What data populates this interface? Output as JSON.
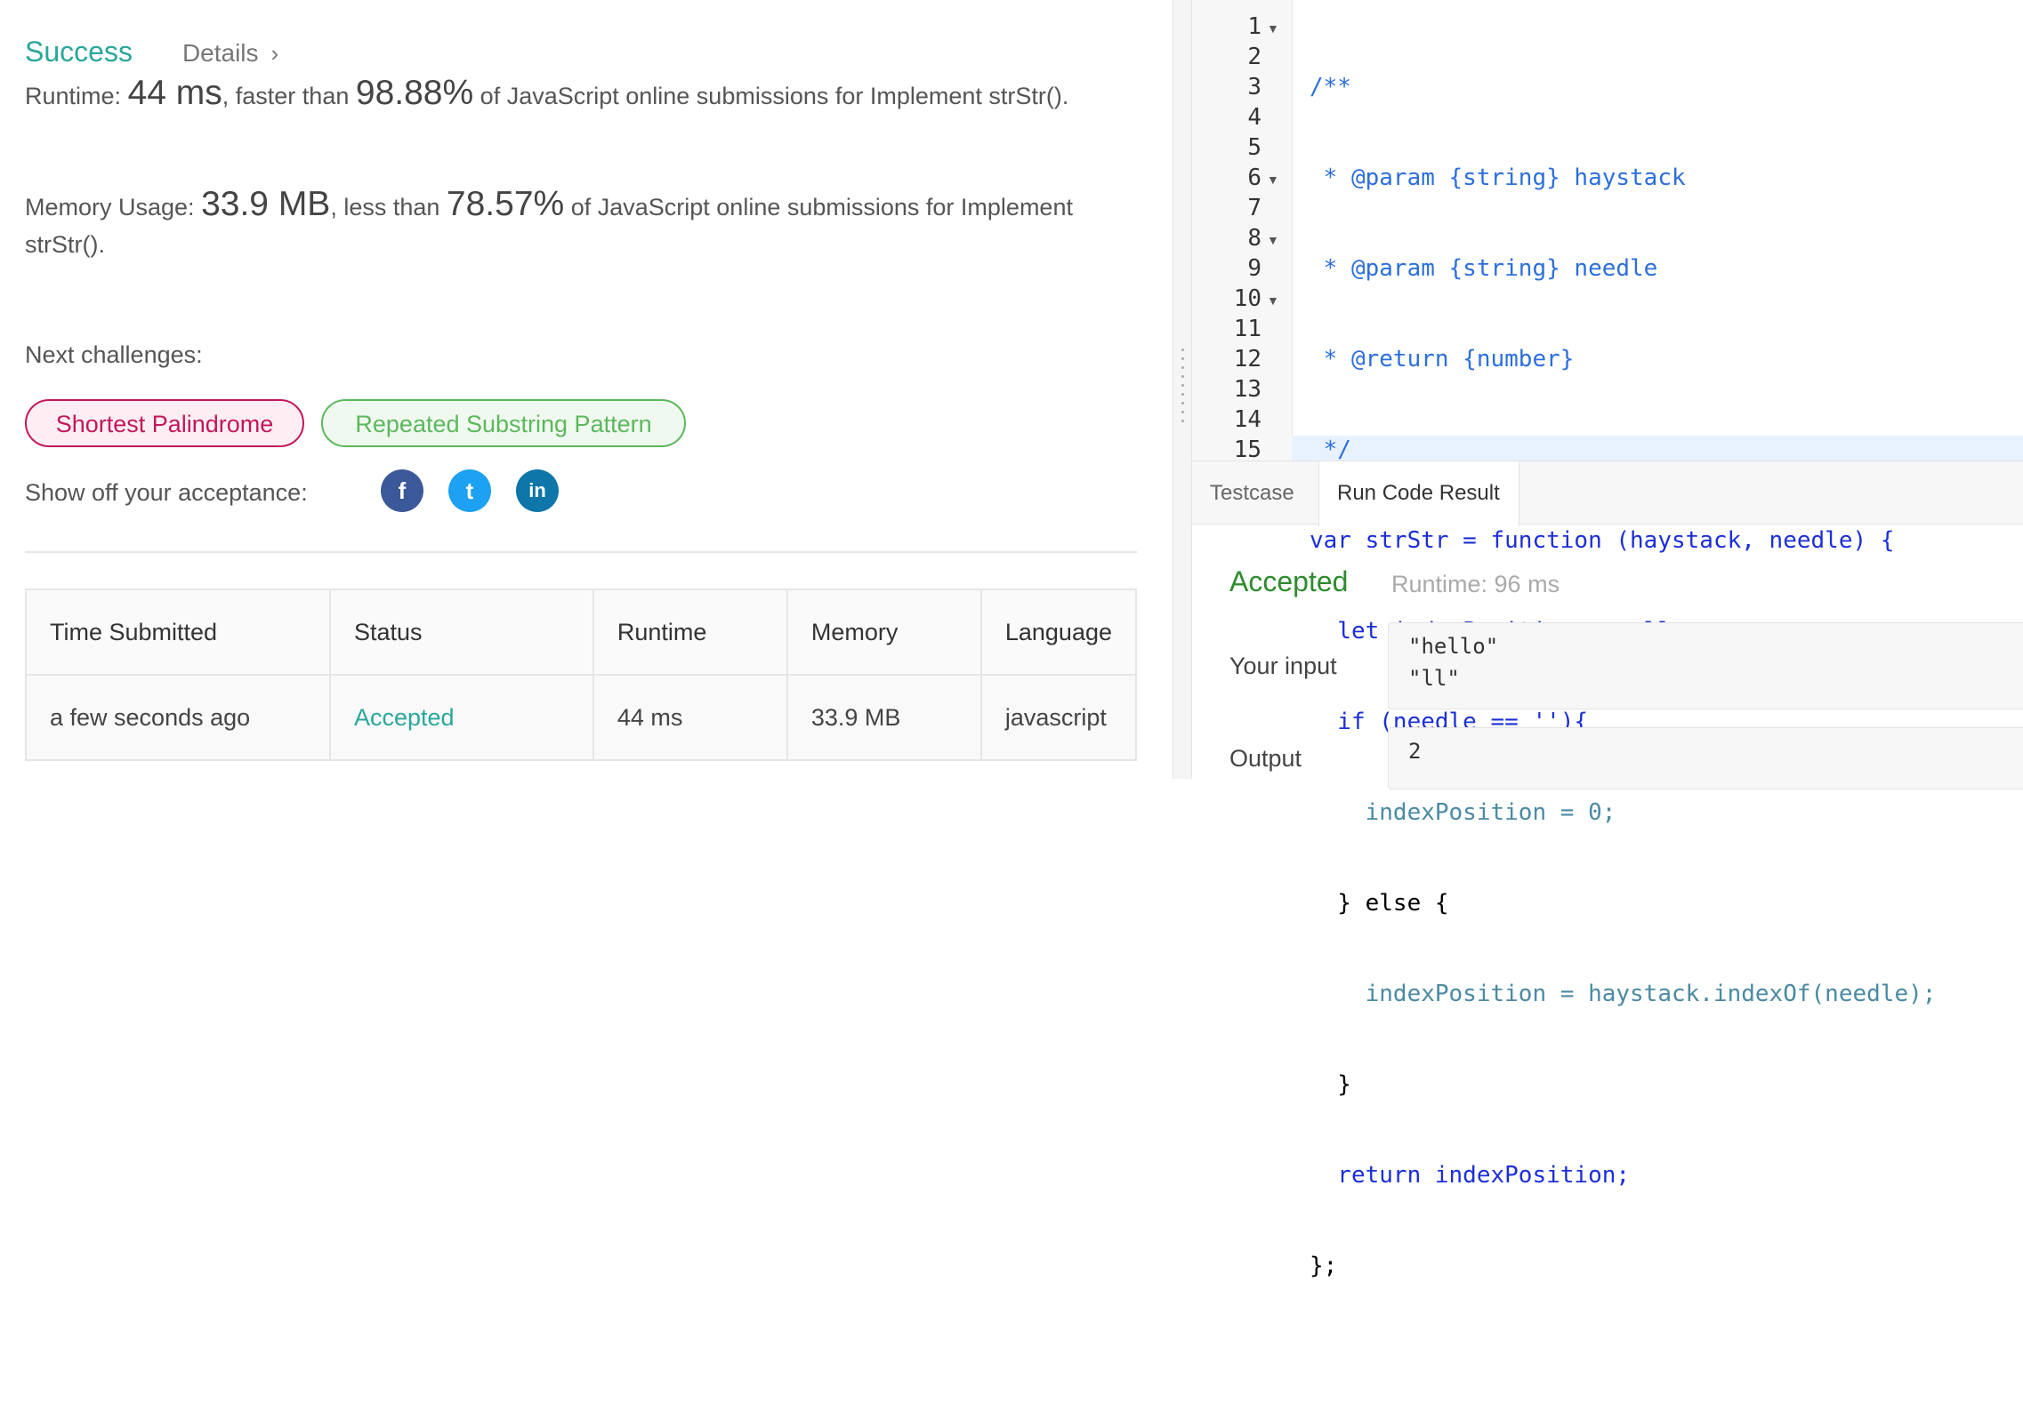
{
  "result": {
    "status": "Success",
    "details_label": "Details",
    "details_chevron": "›",
    "runtime_label": "Runtime:",
    "runtime_value": "44 ms",
    "runtime_mid": ", faster than",
    "runtime_pct": "98.88%",
    "runtime_tail": "of JavaScript online submissions for Implement strStr().",
    "memory_label": "Memory Usage:",
    "memory_value": "33.9 MB",
    "memory_mid": ", less than",
    "memory_pct": "78.57%",
    "memory_tail": "of JavaScript online submissions for Implement strStr().",
    "next_label": "Next challenges:",
    "challenges": [
      "Shortest Palindrome",
      "Repeated Substring Pattern"
    ],
    "share_label": "Show off your acceptance:",
    "social_icons": [
      "facebook-icon",
      "twitter-icon",
      "linkedin-icon"
    ],
    "social_glyphs": [
      "f",
      "t",
      "in"
    ]
  },
  "submissions": {
    "headers": [
      "Time Submitted",
      "Status",
      "Runtime",
      "Memory",
      "Language"
    ],
    "rows": [
      {
        "time": "a few seconds ago",
        "status": "Accepted",
        "runtime": "44 ms",
        "memory": "33.9 MB",
        "language": "javascript"
      }
    ],
    "status_color": "#2aa79b"
  },
  "editor": {
    "line_numbers": [
      "1",
      "2",
      "3",
      "4",
      "5",
      "6",
      "7",
      "8",
      "9",
      "10",
      "11",
      "12",
      "13",
      "14",
      "15"
    ],
    "folded_lines": [
      "1",
      "6",
      "8",
      "10"
    ],
    "code_lines": [
      "/**",
      " * @param {string} haystack",
      " * @param {string} needle",
      " * @return {number}",
      " */",
      "var strStr = function (haystack, needle) {",
      "  let indexPosition = null;",
      "  if (needle == ''){",
      "    indexPosition = 0;",
      "  } else {",
      "    indexPosition = haystack.indexOf(needle);",
      "  }",
      "  return indexPosition;",
      "};",
      ""
    ]
  },
  "console": {
    "tabs": [
      "Testcase",
      "Run Code Result"
    ],
    "active_tab": "Run Code Result",
    "verdict": "Accepted",
    "runtime": "Runtime: 96 ms",
    "input_label": "Your input",
    "input_value": "\"hello\"\n\"ll\"",
    "output_label": "Output",
    "output_value": "2"
  },
  "colors": {
    "success": "#2aa79b",
    "accepted": "#2e8b2e",
    "challenge_hard": "#c2185b",
    "challenge_easy": "#5cb85c"
  }
}
